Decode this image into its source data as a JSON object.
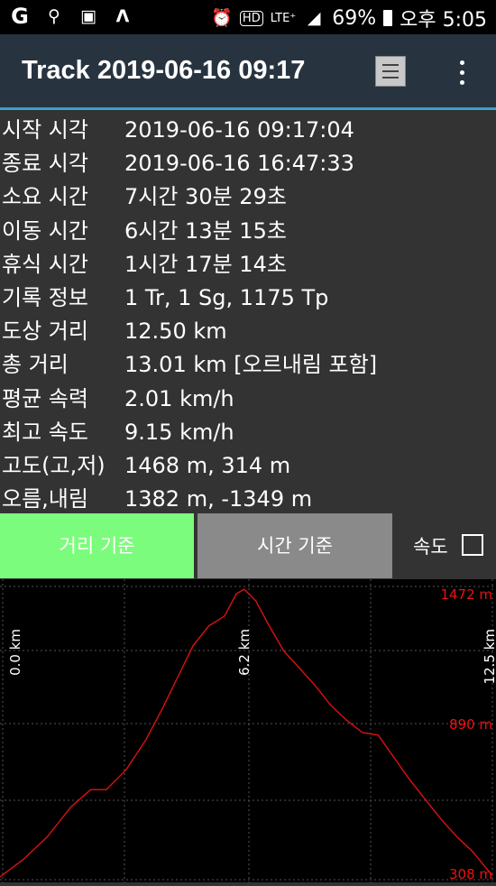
{
  "status_bar": {
    "battery": "69%",
    "time": "오후 5:05",
    "network": "LTE⁺",
    "hd": "HD"
  },
  "app_bar": {
    "title": "Track 2019-06-16 09:17"
  },
  "track_info": [
    {
      "label": "시작 시각",
      "value": "2019-06-16 09:17:04"
    },
    {
      "label": "종료 시각",
      "value": "2019-06-16 16:47:33"
    },
    {
      "label": "소요 시간",
      "value": "7시간 30분 29초"
    },
    {
      "label": "이동 시간",
      "value": "6시간 13분 15초"
    },
    {
      "label": "휴식 시간",
      "value": "1시간 17분 14초"
    },
    {
      "label": "기록 정보",
      "value": "1 Tr, 1 Sg, 1175 Tp"
    },
    {
      "label": "도상 거리",
      "value": "12.50 km"
    },
    {
      "label": "총 거리",
      "value": "13.01 km [오르내림 포함]"
    },
    {
      "label": "평균 속력",
      "value": "2.01 km/h"
    },
    {
      "label": "최고 속도",
      "value": "9.15 km/h"
    },
    {
      "label": "고도(고,저)",
      "value": "1468 m, 314 m"
    },
    {
      "label": "오름,내림",
      "value": "1382 m, -1349 m"
    }
  ],
  "controls": {
    "distance_button": "거리 기준",
    "time_button": "시간 기준",
    "speed_label": "속도",
    "speed_checked": false
  },
  "chart_data": {
    "type": "line",
    "x_unit": "km",
    "y_unit": "m",
    "x_tick_labels": [
      "0.0 km",
      "6.2 km",
      "12.5 km"
    ],
    "y_tick_labels": [
      "1472 m",
      "890 m",
      "308 m"
    ],
    "xlim": [
      0,
      12.5
    ],
    "ylim": [
      308,
      1472
    ],
    "line_color": "#dd1111",
    "series": [
      {
        "x": [
          0,
          0.6,
          1.2,
          1.8,
          2.3,
          2.7,
          3.2,
          3.7,
          4.1,
          4.5,
          4.9,
          5.3,
          5.7,
          6.0,
          6.2,
          6.5,
          6.8,
          7.2,
          7.6,
          8.0,
          8.4,
          8.8,
          9.2,
          9.6,
          10.0,
          10.4,
          10.8,
          11.2,
          11.6,
          12.0,
          12.5
        ],
        "y": [
          308,
          380,
          470,
          590,
          660,
          660,
          740,
          860,
          980,
          1110,
          1240,
          1320,
          1360,
          1450,
          1468,
          1420,
          1330,
          1220,
          1150,
          1080,
          1000,
          940,
          890,
          880,
          790,
          700,
          620,
          540,
          470,
          410,
          314
        ]
      }
    ]
  }
}
